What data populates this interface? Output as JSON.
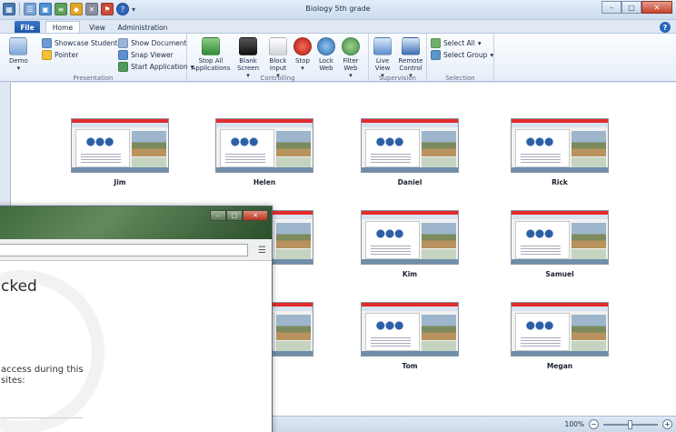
{
  "window": {
    "title": "Biology 5th grade"
  },
  "tabs": [
    {
      "label": "File"
    },
    {
      "label": "Home"
    },
    {
      "label": "View"
    },
    {
      "label": "Administration"
    }
  ],
  "ribbon": {
    "presentation": {
      "label": "Presentation",
      "demo": "Demo",
      "showcase": "Showcase Student",
      "pointer": "Pointer",
      "show_document": "Show Document",
      "snap_viewer": "Snap Viewer",
      "start_application": "Start Application"
    },
    "controlling": {
      "label": "Controlling",
      "stop_all": "Stop All Applications",
      "blank": "Blank Screen",
      "block": "Block Input",
      "stop": "Stop",
      "lock": "Lock Web",
      "filter": "Filter Web"
    },
    "supervision": {
      "label": "Supervision",
      "live": "Live View",
      "remote": "Remote Control"
    },
    "selection": {
      "label": "Selection",
      "select_all": "Select All",
      "select_group": "Select Group"
    }
  },
  "students": [
    {
      "name": "Jim"
    },
    {
      "name": "Helen"
    },
    {
      "name": "Daniel"
    },
    {
      "name": "Rick"
    },
    {
      "name": "Kim"
    },
    {
      "name": "Samuel"
    },
    {
      "name": "Tom"
    },
    {
      "name": "Megan"
    }
  ],
  "status": {
    "zoom": "100%"
  },
  "browser": {
    "heading_fragment": "cked",
    "message_line1": "access during this",
    "message_line2": "sites:"
  },
  "colors": {
    "accent": "#1d53a6",
    "thumb_bar": "#e32b2b"
  }
}
